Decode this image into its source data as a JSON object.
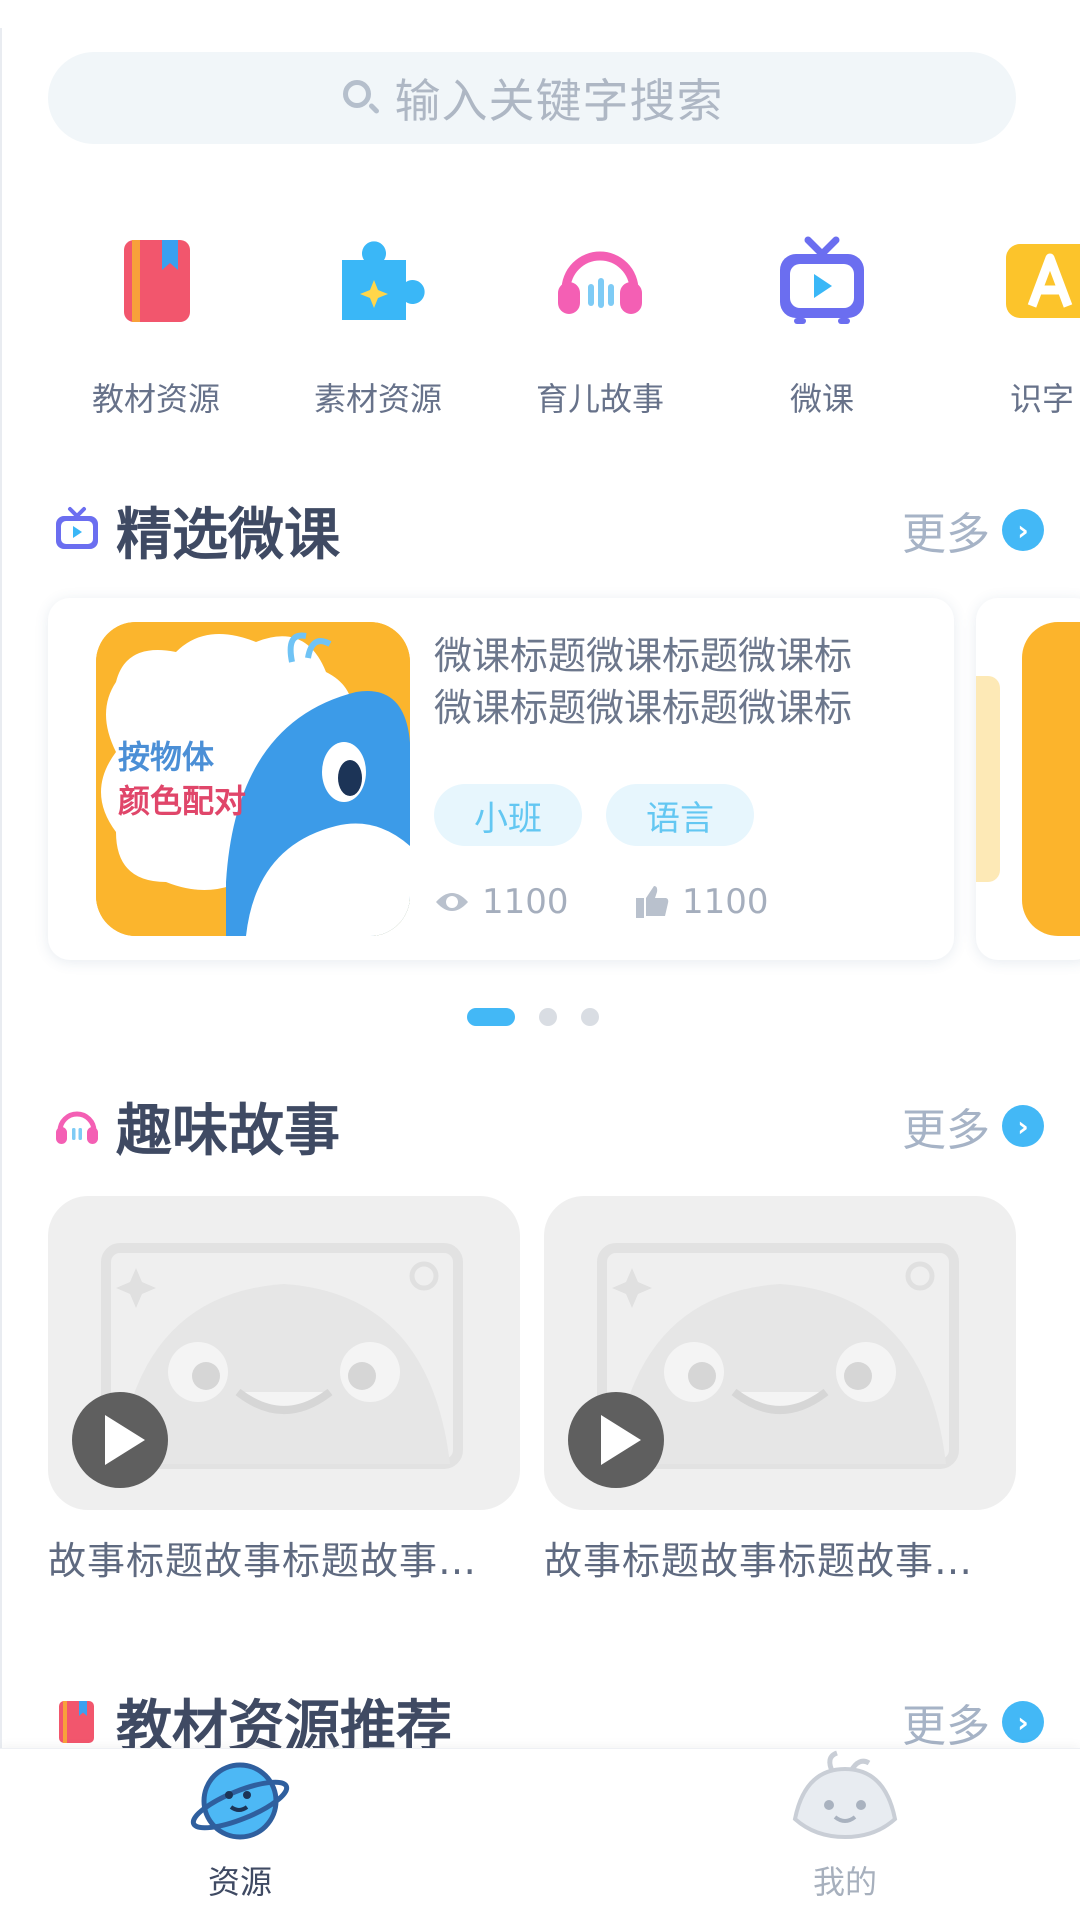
{
  "search": {
    "placeholder": "输入关键字搜索"
  },
  "categories": [
    {
      "label": "教材资源",
      "icon": "book-icon",
      "color": "#f2566d"
    },
    {
      "label": "素材资源",
      "icon": "puzzle-icon",
      "color": "#3ab7f7"
    },
    {
      "label": "育儿故事",
      "icon": "headphones-icon",
      "color": "#f45fb4"
    },
    {
      "label": "微课",
      "icon": "tv-icon",
      "color": "#6b6ef0"
    },
    {
      "label": "识字",
      "icon": "letter-a-icon",
      "color": "#fcc42b"
    }
  ],
  "featured": {
    "title": "精选微课",
    "more": "更多",
    "lesson": {
      "title_line1": "微课标题微课标题微课标",
      "title_line2": "微课标题微课标题微课标",
      "thumb_text_line1": "按物体",
      "thumb_text_line2": "颜色配对",
      "tags": [
        "小班",
        "语言"
      ],
      "views": "1100",
      "likes": "1100"
    },
    "carousel_pages": 3,
    "carousel_active": 0
  },
  "stories": {
    "title": "趣味故事",
    "more": "更多",
    "items": [
      {
        "title": "故事标题故事标题故事…"
      },
      {
        "title": "故事标题故事标题故事…"
      }
    ]
  },
  "textbook": {
    "title": "教材资源推荐",
    "more": "更多"
  },
  "tabbar": {
    "tabs": [
      {
        "label": "资源",
        "active": true
      },
      {
        "label": "我的",
        "active": false
      }
    ]
  },
  "colors": {
    "accent": "#43b8f6",
    "title": "#3f4a63",
    "muted": "#a6b3c6"
  }
}
